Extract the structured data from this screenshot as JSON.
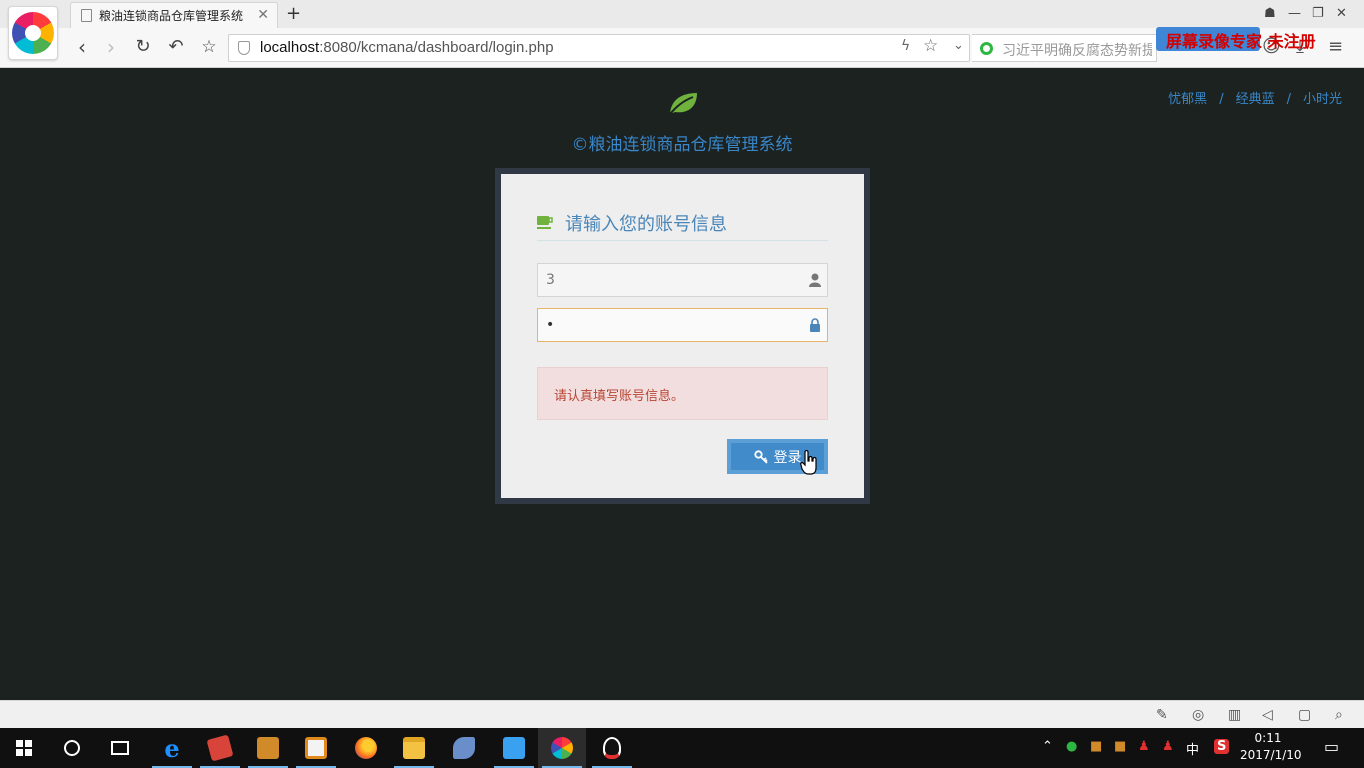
{
  "browser": {
    "tab_title": "粮油连锁商品仓库管理系统",
    "tab_close": "✕",
    "new_tab": "+",
    "url_host": "localhost",
    "url_rest": ":8080/kcmana/dashboard/login.php",
    "search_placeholder": "习近平明确反腐态势新提",
    "recorder_watermark": "屏幕录像专家 未注册",
    "icons": [
      "back-icon",
      "forward-icon",
      "reload-icon",
      "undo-icon",
      "star-icon",
      "shield-icon",
      "flash-icon",
      "bookmark-icon",
      "dropdown-icon",
      "menu-icon"
    ]
  },
  "page": {
    "themes": [
      "忧郁黑",
      "经典蓝",
      "小时光"
    ],
    "theme_sep": "/",
    "app_title": "©粮油连锁商品仓库管理系统",
    "login_title": "请输入您的账号信息",
    "username_value": "3",
    "password_mask": "•",
    "error_message": "请认真填写账号信息。",
    "login_button": "登录"
  },
  "taskbar": {
    "clock_time": "0:11",
    "clock_date": "2017/1/10",
    "ime": "中",
    "apps": [
      "start-icon",
      "search-icon",
      "task-view-icon",
      "edge-icon",
      "app-red-icon",
      "app-book-icon",
      "app-viewer-icon",
      "firefox-icon",
      "explorer-icon",
      "dolphin-icon",
      "baidu-cloud-icon",
      "browser-wheel-icon",
      "qq-icon"
    ]
  },
  "colors": {
    "page_bg": "#1b2220",
    "link": "#3a86c8",
    "button": "#428bca",
    "alert_bg": "#f2dede",
    "alert_text": "#b74635",
    "leaf": "#6fb23d"
  }
}
